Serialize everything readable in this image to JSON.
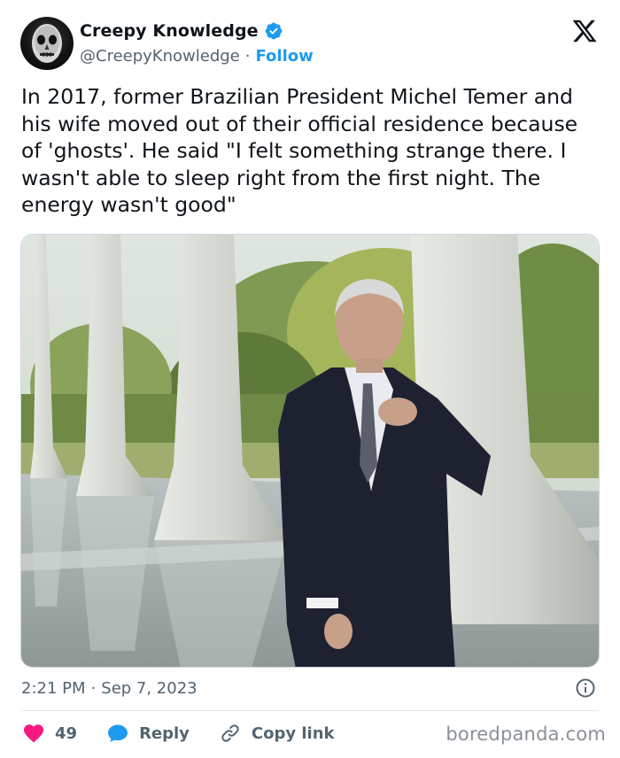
{
  "author": {
    "display_name": "Creepy Knowledge",
    "handle": "@CreepyKnowledge",
    "separator": "·",
    "follow_label": "Follow"
  },
  "tweet": {
    "text": "In 2017, former Brazilian President Michel Temer and his wife moved out of their official residence because of 'ghosts'. He said \"I felt something strange there. I wasn't able to sleep right from the first night. The energy wasn't good\"",
    "time": "2:21 PM",
    "separator": "·",
    "date": "Sep 7, 2023"
  },
  "actions": {
    "like_count": "49",
    "reply_label": "Reply",
    "copy_link_label": "Copy link"
  },
  "watermark": "boredpanda.com",
  "icons": {
    "verified": "verified-badge-icon",
    "platform": "x-logo-icon",
    "info": "info-icon",
    "like": "heart-icon",
    "reply": "speech-bubble-icon",
    "copy": "link-icon"
  },
  "colors": {
    "accent": "#1d9bf0",
    "like": "#f91880",
    "muted_text": "#536471",
    "text": "#0f1419"
  }
}
